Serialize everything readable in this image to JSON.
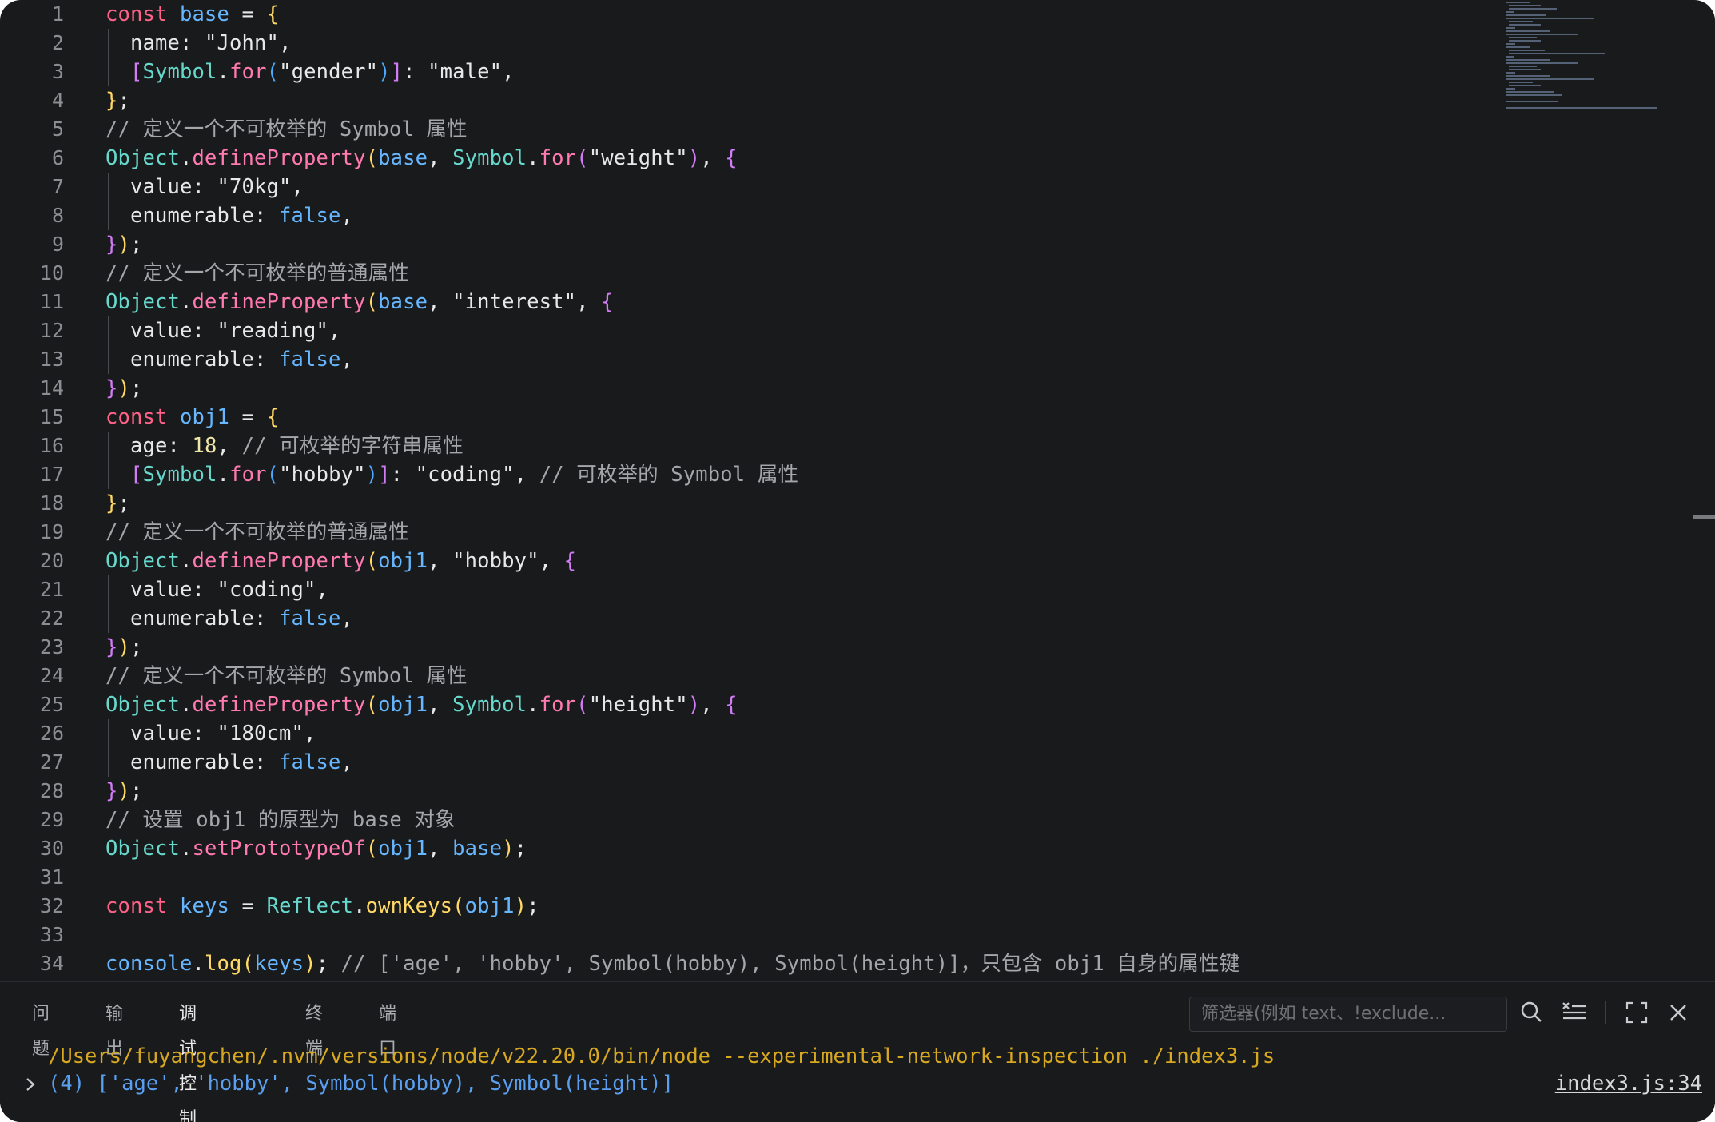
{
  "editor": {
    "line_numbers": [
      "1",
      "2",
      "3",
      "4",
      "5",
      "6",
      "7",
      "8",
      "9",
      "10",
      "11",
      "12",
      "13",
      "14",
      "15",
      "16",
      "17",
      "18",
      "19",
      "20",
      "21",
      "22",
      "23",
      "24",
      "25",
      "26",
      "27",
      "28",
      "29",
      "30",
      "31",
      "32",
      "33",
      "34"
    ],
    "comments": {
      "l5": "// 定义一个不可枚举的 Symbol 属性",
      "l10": "// 定义一个不可枚举的普通属性",
      "l16": "// 可枚举的字符串属性",
      "l17": "// 可枚举的 Symbol 属性",
      "l19": "// 定义一个不可枚举的普通属性",
      "l24": "// 定义一个不可枚举的 Symbol 属性",
      "l29": "// 设置 obj1 的原型为 base 对象",
      "l34": "// ['age', 'hobby', Symbol(hobby), Symbol(height)]，只包含 obj1 自身的属性键"
    }
  },
  "panel": {
    "tabs": [
      "问题",
      "输出",
      "调试控制台",
      "终端",
      "端口"
    ],
    "active_tab": "调试控制台",
    "filter_placeholder": "筛选器(例如 text、!exclude...",
    "command_line": "/Users/fuyangchen/.nvm/versions/node/v22.20.0/bin/node --experimental-network-inspection ./index3.js",
    "output_line": "(4) ['age', 'hobby', Symbol(hobby), Symbol(height)]",
    "source_link": "index3.js:34"
  },
  "icons": [
    "search-icon",
    "clear-console-icon",
    "maximize-panel-icon",
    "close-panel-icon",
    "chevron-right-icon"
  ],
  "colors": {
    "background": "#191a1c",
    "keyword": "#ff6188",
    "variable": "#66b7ff",
    "class": "#66d9cc",
    "command_output": "#d8a820",
    "log_output": "#5a9ff0",
    "active_tab_underline": "#3b8eea"
  }
}
